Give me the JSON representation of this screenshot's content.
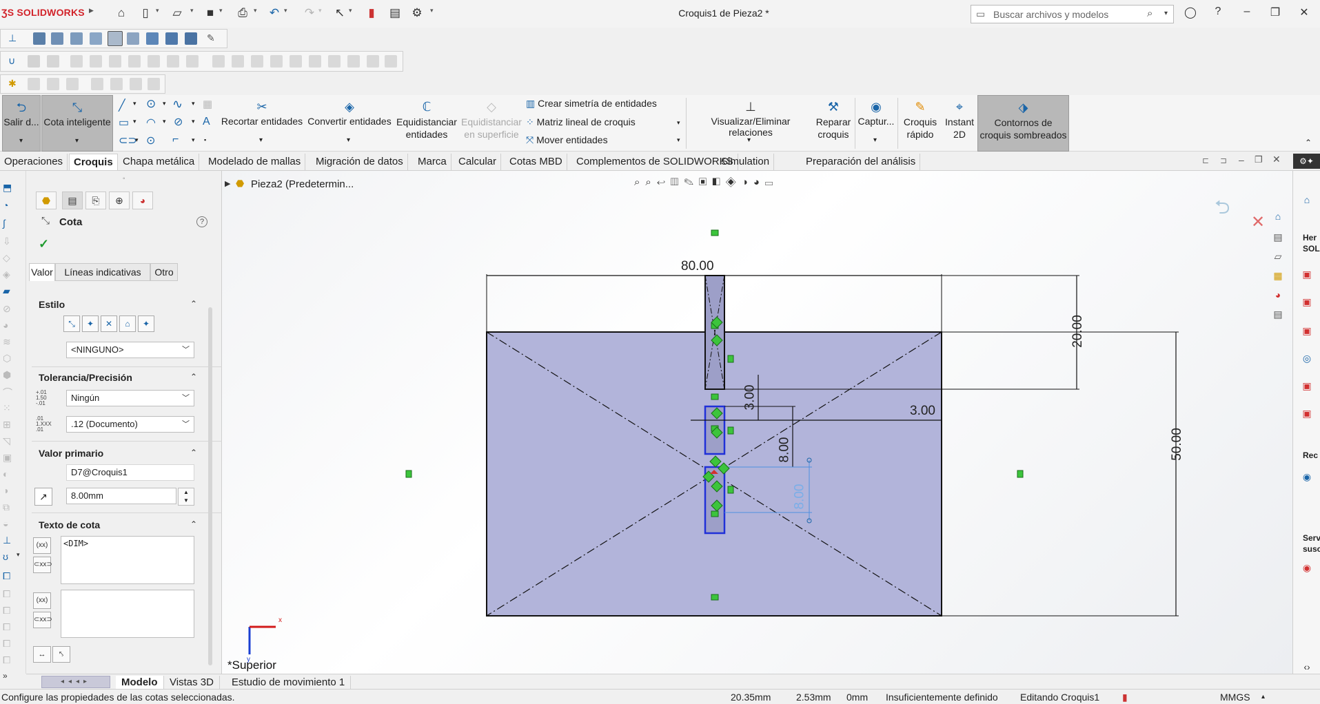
{
  "app": {
    "logo_text": "SOLIDWORKS",
    "document_title": "Croquis1 de Pieza2 *",
    "search_placeholder": "Buscar archivos y modelos"
  },
  "command_manager": {
    "exit_sketch": "Salir d...",
    "smart_dimension": "Cota inteligente",
    "trim": "Recortar entidades",
    "convert": "Convertir entidades",
    "offset_line1": "Equidistanciar",
    "offset_line2": "entidades",
    "offset_surface_line1": "Equidistanciar",
    "offset_surface_line2": "en superficie",
    "mirror": "Crear simetría de entidades",
    "linear_pattern": "Matriz lineal de croquis",
    "move": "Mover entidades",
    "relations": "Visualizar/Eliminar relaciones",
    "repair_line1": "Reparar",
    "repair_line2": "croquis",
    "capture": "Captur...",
    "quick_sketch_line1": "Croquis",
    "quick_sketch_line2": "rápido",
    "instant2d_line1": "Instant",
    "instant2d_line2": "2D",
    "shaded_line1": "Contornos de",
    "shaded_line2": "croquis sombreados"
  },
  "tabs": [
    "Operaciones",
    "Croquis",
    "Chapa metálica",
    "Modelado de mallas",
    "Migración de datos",
    "Marca",
    "Calcular",
    "Cotas MBD",
    "Complementos de SOLIDWORKS",
    "Simulation",
    "Preparación del análisis"
  ],
  "tree": {
    "root": "Pieza2 (Predetermin..."
  },
  "property_manager": {
    "title": "Cota",
    "subtabs": [
      "Valor",
      "Líneas indicativas",
      "Otro"
    ],
    "style_header": "Estilo",
    "style_value": "<NINGUNO>",
    "tolerance_header": "Tolerancia/Precisión",
    "tolerance_value": "Ningún",
    "precision_value": ".12 (Documento)",
    "primary_header": "Valor primario",
    "primary_name": "D7@Croquis1",
    "primary_value": "8.00mm",
    "dimtext_header": "Texto de cota",
    "dimtext_value": "<DIM>"
  },
  "sketch": {
    "dim_80": "80.00",
    "dim_20": "20.00",
    "dim_50": "50.00",
    "dim_3_v": "3.00",
    "dim_3_h": "3.00",
    "dim_8_v": "8.00",
    "dim_8_active": "8.00",
    "view_label": "*Superior",
    "axis_x": "x",
    "axis_y": "y"
  },
  "bottom_tabs": [
    "Modelo",
    "Vistas 3D",
    "Estudio de movimiento 1"
  ],
  "status": {
    "message": "Configure las propiedades de las cotas seleccionadas.",
    "x": "20.35mm",
    "y": "2.53mm",
    "z": "0mm",
    "definition": "Insuficientemente definido",
    "editing": "Editando Croquis1",
    "units": "MMGS"
  },
  "right_panel": {
    "t1": "Her",
    "t2": "SOL",
    "t3": "Rec",
    "t4": "Serv",
    "t5": "susc"
  }
}
